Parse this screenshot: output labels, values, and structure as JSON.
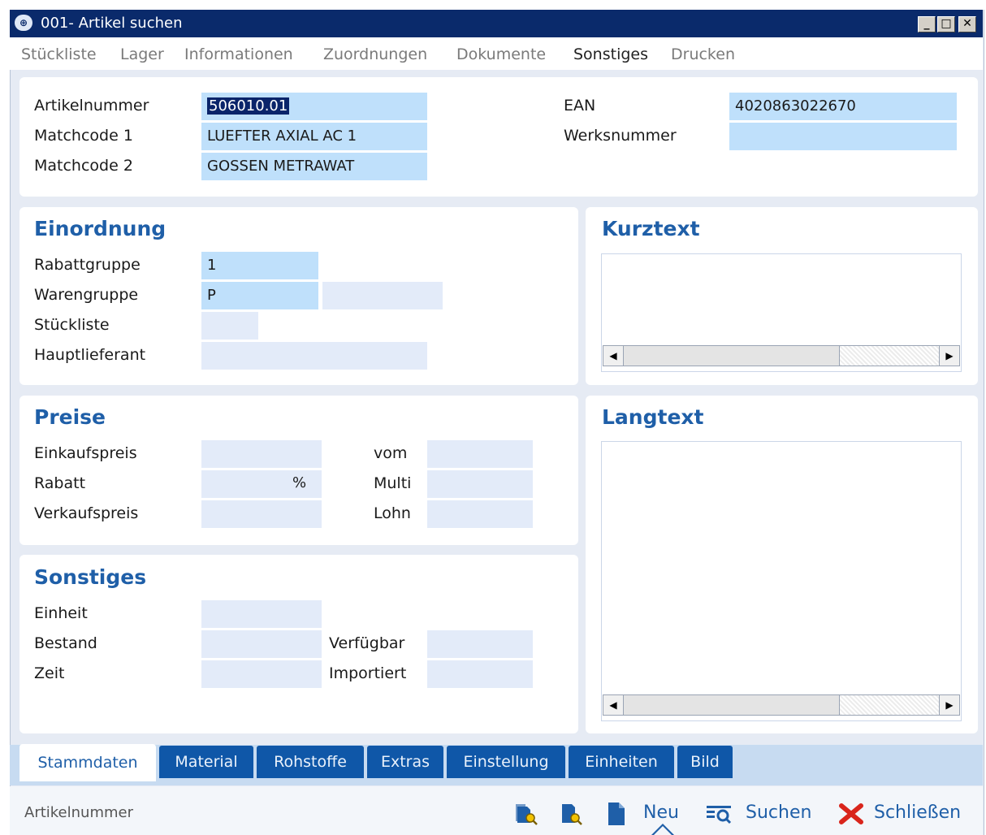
{
  "window": {
    "title": "001- Artikel suchen"
  },
  "menu": [
    "Stückliste",
    "Lager",
    "Informationen",
    "Zuordnungen",
    "Dokumente",
    "Sonstiges",
    "Drucken"
  ],
  "menu_active": "Sonstiges",
  "header": {
    "artikelnummer_label": "Artikelnummer",
    "artikelnummer_value": "506010.01",
    "matchcode1_label": "Matchcode 1",
    "matchcode1_value": "LUEFTER AXIAL AC 1",
    "matchcode2_label": "Matchcode 2",
    "matchcode2_value": "GOSSEN METRAWAT",
    "ean_label": "EAN",
    "ean_value": "4020863022670",
    "werksnummer_label": "Werksnummer",
    "werksnummer_value": ""
  },
  "einordnung": {
    "title": "Einordnung",
    "rabattgruppe_label": "Rabattgruppe",
    "rabattgruppe_value": "1",
    "warengruppe_label": "Warengruppe",
    "warengruppe_value": "P",
    "stueckliste_label": "Stückliste",
    "hauptlieferant_label": "Hauptlieferant"
  },
  "kurztext": {
    "title": "Kurztext"
  },
  "langtext": {
    "title": "Langtext"
  },
  "preise": {
    "title": "Preise",
    "einkaufspreis_label": "Einkaufspreis",
    "rabatt_label": "Rabatt",
    "rabatt_unit": "%",
    "verkaufspreis_label": "Verkaufspreis",
    "vom_label": "vom",
    "multi_label": "Multi",
    "lohn_label": "Lohn"
  },
  "sonstiges": {
    "title": "Sonstiges",
    "einheit_label": "Einheit",
    "bestand_label": "Bestand",
    "zeit_label": "Zeit",
    "verfuegbar_label": "Verfügbar",
    "importiert_label": "Importiert"
  },
  "tabs": [
    "Stammdaten",
    "Material",
    "Rohstoffe",
    "Extras",
    "Einstellung",
    "Einheiten",
    "Bild"
  ],
  "tab_active": "Stammdaten",
  "status": {
    "field_hint": "Artikelnummer",
    "neu_label": "Neu",
    "suchen_label": "Suchen",
    "schliessen_label": "Schließen"
  },
  "colors": {
    "titlebar": "#0a2a6b",
    "accent": "#1f5fa8",
    "tab": "#0f57a8",
    "close_red": "#d9251c"
  },
  "icons": [
    "app-logo-icon",
    "document-search-icon",
    "document-search-icon-2",
    "new-document-icon",
    "search-list-icon",
    "close-x-icon"
  ]
}
